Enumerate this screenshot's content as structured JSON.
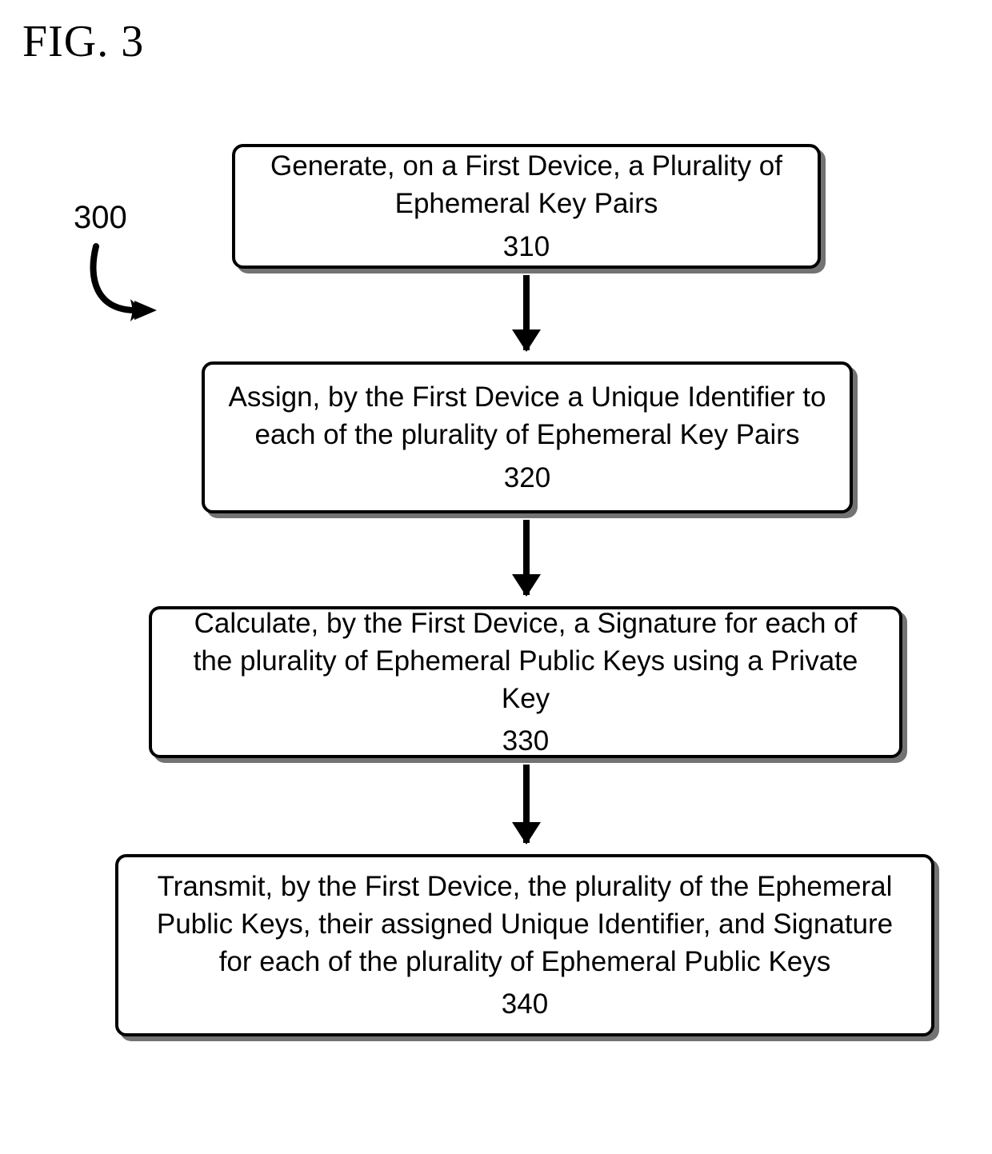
{
  "figure": {
    "title": "FIG. 3",
    "reference_label": "300"
  },
  "steps": {
    "s310": {
      "text": "Generate, on a First Device, a Plurality of Ephemeral Key Pairs",
      "number": "310"
    },
    "s320": {
      "text": "Assign, by the First Device a Unique Identifier to each of the plurality of Ephemeral Key Pairs",
      "number": "320"
    },
    "s330": {
      "text": "Calculate, by the First Device, a Signature for each of the plurality of Ephemeral Public Keys using a Private Key",
      "number": "330"
    },
    "s340": {
      "text": "Transmit, by the First Device, the plurality of the Ephemeral Public Keys, their assigned Unique Identifier, and Signature for each of the plurality of Ephemeral Public Keys",
      "number": "340"
    }
  }
}
